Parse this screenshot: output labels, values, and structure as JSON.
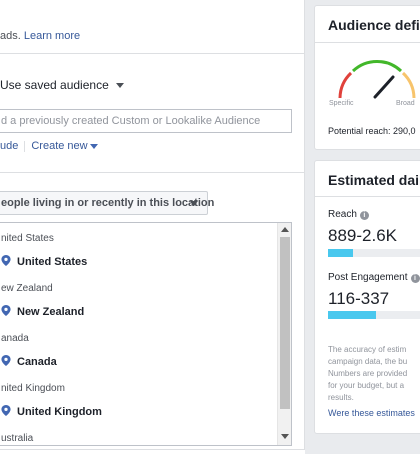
{
  "left_panel": {
    "intro_fragment": "ads.",
    "learn_more": "Learn more",
    "saved_audience_label": "Use saved audience",
    "search_placeholder": "d a previously created Custom or Lookalike Audience",
    "exclude_link": "ude",
    "create_new_link": "Create new",
    "location_dropdown": "eople living in or recently in this location",
    "locations": [
      {
        "heading": "nited States",
        "item": "United States"
      },
      {
        "heading": "ew Zealand",
        "item": "New Zealand"
      },
      {
        "heading": "anada",
        "item": "Canada"
      },
      {
        "heading": "nited Kingdom",
        "item": "United Kingdom"
      },
      {
        "heading": "ustralia",
        "item": ""
      }
    ]
  },
  "audience_card": {
    "title": "Audience defin",
    "gauge_left": "Specific",
    "gauge_right": "Broad",
    "potential_reach": "Potential reach: 290,0"
  },
  "estimated_card": {
    "title": "Estimated daily",
    "reach_label": "Reach",
    "reach_value": "889-2.6K",
    "reach_fill": 0.23,
    "engagement_label": "Post Engagement",
    "engagement_value": "116-337",
    "engagement_fill": 0.45,
    "disclaimer_lines": [
      "The accuracy of estim",
      "campaign data, the bu",
      "Numbers are provided",
      "for your budget, but a",
      "results."
    ],
    "feedback_link": "Were these estimates"
  },
  "colors": {
    "link": "#365899",
    "bar_fill": "#49c8ee",
    "pin": "#4267b2",
    "gauge_red": "#e0413b",
    "gauge_green": "#42b72a",
    "gauge_yellow": "#f7c46c"
  },
  "icons": [
    "caret-down-icon",
    "pin-icon",
    "info-icon",
    "gauge-icon",
    "scroll-up-icon",
    "scroll-down-icon"
  ]
}
